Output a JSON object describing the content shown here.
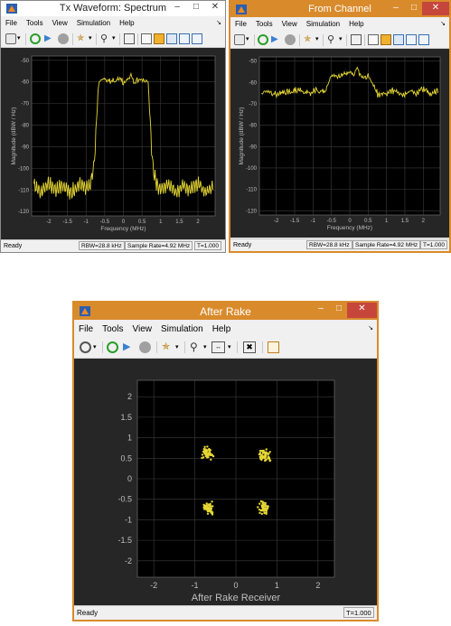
{
  "colors": {
    "active_title": "#ffffff",
    "inactive_title": "#d98b2c",
    "plot_bg": "#262626",
    "axes_bg": "#000000",
    "grid": "#3c3c3c",
    "trace": "#e5d633",
    "tick_text": "#bfbfbf"
  },
  "menu": [
    "File",
    "Tools",
    "View",
    "Simulation",
    "Help"
  ],
  "window1": {
    "title": "Tx Waveform: Spectrum",
    "ylabel": "Magnitude (dBW / Hz)",
    "xlabel": "Frequency (MHz)",
    "status_ready": "Ready",
    "rbw": "RBW=28.8 kHz",
    "sample_rate": "Sample Rate=4.92 MHz",
    "time": "T=1.000"
  },
  "window2": {
    "title": "From Channel",
    "ylabel": "Magnitude (dBW / Hz)",
    "xlabel": "Frequency (MHz)",
    "status_ready": "Ready",
    "rbw": "RBW=28.8 kHz",
    "sample_rate": "Sample Rate=4.92 MHz",
    "time": "T=1.000"
  },
  "window3": {
    "title": "After Rake",
    "xlabel": "After Rake Receiver",
    "status_ready": "Ready",
    "time": "T=1.000"
  },
  "chart_data": [
    {
      "type": "line",
      "xlabel": "Frequency (MHz)",
      "ylabel": "Magnitude (dBW / Hz)",
      "xlim": [
        -2.46,
        2.46
      ],
      "ylim": [
        -122,
        -48
      ],
      "xticks": [
        "-2",
        "-1.5",
        "-1",
        "-0.5",
        "0",
        "0.5",
        "1",
        "1.5",
        "2"
      ],
      "xtick_values": [
        -2,
        -1.5,
        -1,
        -0.5,
        0,
        0.5,
        1,
        1.5,
        2
      ],
      "yticks": [
        "-50",
        "-60",
        "-70",
        "-80",
        "-90",
        "-100",
        "-110",
        "-120"
      ],
      "ytick_values": [
        -50,
        -60,
        -70,
        -80,
        -90,
        -100,
        -110,
        -120
      ],
      "grid": true,
      "series": [
        {
          "x": [
            -2.4,
            -2.2,
            -2.0,
            -1.8,
            -1.6,
            -1.4,
            -1.2,
            -1.0,
            -0.9,
            -0.8,
            -0.75,
            -0.7,
            -0.65,
            -0.5,
            -0.3,
            -0.1,
            0.0,
            0.1,
            0.2,
            0.3,
            0.5,
            0.65,
            0.7,
            0.75,
            0.8,
            0.9,
            1.0,
            1.2,
            1.4,
            1.6,
            1.8,
            2.0,
            2.2,
            2.4
          ],
          "y": [
            -108,
            -111,
            -107,
            -110,
            -108,
            -112,
            -107,
            -109,
            -108,
            -100,
            -90,
            -70,
            -60,
            -59,
            -60,
            -58,
            -60,
            -59,
            -57,
            -60,
            -59,
            -60,
            -70,
            -90,
            -100,
            -108,
            -110,
            -107,
            -111,
            -108,
            -110,
            -107,
            -111,
            -108
          ]
        }
      ]
    },
    {
      "type": "line",
      "xlabel": "Frequency (MHz)",
      "ylabel": "Magnitude (dBW / Hz)",
      "xlim": [
        -2.46,
        2.46
      ],
      "ylim": [
        -122,
        -48
      ],
      "xticks": [
        "-2",
        "-1.5",
        "-1",
        "-0.5",
        "0",
        "0.5",
        "1",
        "1.5",
        "2"
      ],
      "xtick_values": [
        -2,
        -1.5,
        -1,
        -0.5,
        0,
        0.5,
        1,
        1.5,
        2
      ],
      "yticks": [
        "-50",
        "-60",
        "-70",
        "-80",
        "-90",
        "-100",
        "-110",
        "-120"
      ],
      "ytick_values": [
        -50,
        -60,
        -70,
        -80,
        -90,
        -100,
        -110,
        -120
      ],
      "grid": true,
      "series": [
        {
          "x": [
            -2.4,
            -2.2,
            -2.0,
            -1.8,
            -1.6,
            -1.4,
            -1.2,
            -1.0,
            -0.8,
            -0.7,
            -0.6,
            -0.5,
            -0.3,
            -0.1,
            0.0,
            0.1,
            0.2,
            0.3,
            0.5,
            0.6,
            0.7,
            0.8,
            1.0,
            1.2,
            1.4,
            1.6,
            1.8,
            2.0,
            2.2,
            2.4
          ],
          "y": [
            -65,
            -64,
            -66,
            -64,
            -65,
            -63,
            -65,
            -64,
            -64,
            -65,
            -61,
            -57,
            -57,
            -56,
            -55,
            -57,
            -53,
            -58,
            -57,
            -60,
            -64,
            -66,
            -65,
            -64,
            -66,
            -64,
            -65,
            -63,
            -65,
            -64
          ]
        }
      ]
    },
    {
      "type": "scatter",
      "xlabel": "After Rake Receiver",
      "xlim": [
        -2.4,
        2.4
      ],
      "ylim": [
        -2.4,
        2.4
      ],
      "xticks": [
        "-2",
        "-1",
        "0",
        "1",
        "2"
      ],
      "xtick_values": [
        -2,
        -1,
        0,
        1,
        2
      ],
      "yticks": [
        "2",
        "1.5",
        "1",
        "0.5",
        "0",
        "-0.5",
        "-1",
        "-1.5",
        "-2"
      ],
      "ytick_values": [
        2,
        1.5,
        1,
        0.5,
        0,
        -0.5,
        -1,
        -1.5,
        -2
      ],
      "grid": true,
      "clusters": [
        {
          "center": [
            -0.71,
            0.63
          ]
        },
        {
          "center": [
            0.71,
            0.58
          ]
        },
        {
          "center": [
            -0.67,
            -0.72
          ]
        },
        {
          "center": [
            0.68,
            -0.7
          ]
        }
      ]
    }
  ]
}
